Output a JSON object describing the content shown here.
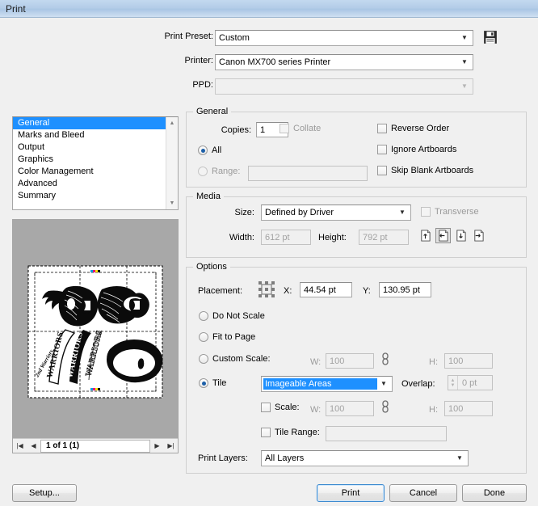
{
  "window": {
    "title": "Print"
  },
  "top": {
    "print_preset_label": "Print Preset:",
    "print_preset_value": "Custom",
    "printer_label": "Printer:",
    "printer_value": "Canon MX700 series Printer",
    "ppd_label": "PPD:",
    "ppd_value": "",
    "save_icon": "floppy-disk-icon"
  },
  "sidebar": {
    "items": [
      {
        "label": "General",
        "selected": true
      },
      {
        "label": "Marks and Bleed",
        "selected": false
      },
      {
        "label": "Output",
        "selected": false
      },
      {
        "label": "Graphics",
        "selected": false
      },
      {
        "label": "Color Management",
        "selected": false
      },
      {
        "label": "Advanced",
        "selected": false
      },
      {
        "label": "Summary",
        "selected": false
      }
    ]
  },
  "preview": {
    "page_nav_value": "1 of 1 (1)",
    "first_icon": "first-page-icon",
    "prev_icon": "previous-page-icon",
    "next_icon": "next-page-icon",
    "last_icon": "last-page-icon",
    "artwork_text": "WARRIORS",
    "artwork_small_text": "2nd Warriors"
  },
  "general": {
    "legend": "General",
    "copies_label": "Copies:",
    "copies_value": "1",
    "collate_label": "Collate",
    "collate_checked": false,
    "all_label": "All",
    "all_selected": true,
    "range_label": "Range:",
    "range_value": "",
    "range_selected": false,
    "reverse_order_label": "Reverse Order",
    "reverse_order_checked": false,
    "ignore_artboards_label": "Ignore Artboards",
    "ignore_artboards_checked": false,
    "skip_blank_label": "Skip Blank Artboards",
    "skip_blank_checked": false
  },
  "media": {
    "legend": "Media",
    "size_label": "Size:",
    "size_value": "Defined by Driver",
    "transverse_label": "Transverse",
    "transverse_checked": false,
    "width_label": "Width:",
    "width_value": "612 pt",
    "height_label": "Height:",
    "height_value": "792 pt",
    "orientations": [
      {
        "name": "portrait-up-icon",
        "selected": false
      },
      {
        "name": "landscape-left-icon",
        "selected": true
      },
      {
        "name": "portrait-down-icon",
        "selected": false
      },
      {
        "name": "landscape-right-icon",
        "selected": false
      }
    ]
  },
  "options": {
    "legend": "Options",
    "placement_label": "Placement:",
    "placement_icon": "anchor-grid-icon",
    "x_label": "X:",
    "x_value": "44.54 pt",
    "y_label": "Y:",
    "y_value": "130.95 pt",
    "do_not_scale_label": "Do Not Scale",
    "do_not_scale_selected": false,
    "fit_to_page_label": "Fit to Page",
    "fit_to_page_selected": false,
    "custom_scale_label": "Custom Scale:",
    "custom_scale_selected": false,
    "custom_w_label": "W:",
    "custom_w_value": "100",
    "custom_h_label": "H:",
    "custom_h_value": "100",
    "link_icon": "chain-link-icon",
    "tile_label": "Tile",
    "tile_selected": true,
    "tile_value": "Imageable Areas",
    "overlap_label": "Overlap:",
    "overlap_value": "0 pt",
    "tile_scale_label": "Scale:",
    "tile_scale_checked": false,
    "tile_w_label": "W:",
    "tile_w_value": "100",
    "tile_h_label": "H:",
    "tile_h_value": "100",
    "tile_link_icon": "chain-link-icon",
    "tile_range_label": "Tile Range:",
    "tile_range_checked": false,
    "tile_range_value": "",
    "print_layers_label": "Print Layers:",
    "print_layers_value": "All Layers"
  },
  "footer": {
    "setup_label": "Setup...",
    "print_label": "Print",
    "cancel_label": "Cancel",
    "done_label": "Done"
  },
  "colors": {
    "accent": "#1e90ff",
    "titlebar": "#b4cde8",
    "dialog_bg": "#f0f0f0",
    "canvas_bg": "#a8a8a8"
  }
}
